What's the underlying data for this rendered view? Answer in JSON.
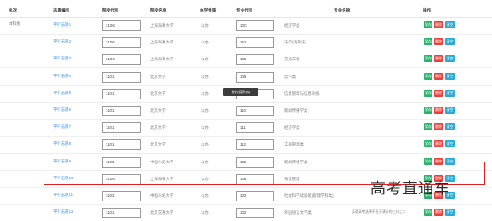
{
  "header": {
    "columns": [
      "批次",
      "志愿编号",
      "院校代号",
      "院校名称",
      "办学性质",
      "专业代号",
      "专业名称",
      "操作"
    ]
  },
  "batch_label": "本科批",
  "buttons": {
    "save": "保存",
    "delete": "删除",
    "clear": "清空"
  },
  "rows": [
    {
      "label": "平行志愿1",
      "school_code": "3106",
      "school_name": "上海海事大学",
      "nature": "公办",
      "major_code": "10C",
      "major_name": "经济学类",
      "note": ""
    },
    {
      "label": "平行志愿2",
      "school_code": "3106",
      "school_name": "上海海事大学",
      "nature": "公办",
      "major_code": "110",
      "major_name": "法学(海商法)",
      "note": ""
    },
    {
      "label": "平行志愿3",
      "school_code": "3106",
      "school_name": "上海海事大学",
      "nature": "公办",
      "major_code": "105",
      "major_name": "交通工程",
      "note": ""
    },
    {
      "label": "平行志愿4",
      "school_code": "1101",
      "school_name": "北京大学",
      "nature": "公办",
      "major_code": "105",
      "major_name": "哲学类",
      "note": ""
    },
    {
      "label": "平行志愿5",
      "school_code": "1101",
      "school_name": "北京大学",
      "nature": "公办",
      "major_code": "104",
      "major_name": "信息管理与信息系统",
      "note": ""
    },
    {
      "label": "平行志愿6",
      "school_code": "1101",
      "school_name": "北京大学",
      "nature": "公办",
      "major_code": "110",
      "major_name": "新闻传播学类",
      "note": ""
    },
    {
      "label": "平行志愿7",
      "school_code": "1101",
      "school_name": "北京大学",
      "nature": "公办",
      "major_code": "111",
      "major_name": "经济学类",
      "note": ""
    },
    {
      "label": "平行志愿8",
      "school_code": "1101",
      "school_name": "北京大学",
      "nature": "公办",
      "major_code": "112",
      "major_name": "工商管理类",
      "note": ""
    },
    {
      "label": "平行志愿9",
      "school_code": "1103",
      "school_name": "中国人民大学",
      "nature": "公办",
      "major_code": "102",
      "major_name": "新闻传播学类",
      "note": ""
    },
    {
      "label": "平行志愿10",
      "school_code": "3106",
      "school_name": "上海海事大学",
      "nature": "公办",
      "major_code": "108",
      "major_name": "物流管理",
      "note": ""
    },
    {
      "label": "平行志愿11",
      "school_code": "1103",
      "school_name": "中国人民大学",
      "nature": "公办",
      "major_code": "103",
      "major_name": "社会科学试验班(管理学科类)",
      "note": ""
    },
    {
      "label": "平行志愿12",
      "school_code": "1101",
      "school_name": "北京交通大学",
      "nature": "公办",
      "major_code": "102",
      "major_name": "外国语言文学类",
      "note": "英语高考选择不低于满分的三分之二"
    }
  ],
  "tooltip": "操作提示(s)",
  "watermark": "高考直通车"
}
